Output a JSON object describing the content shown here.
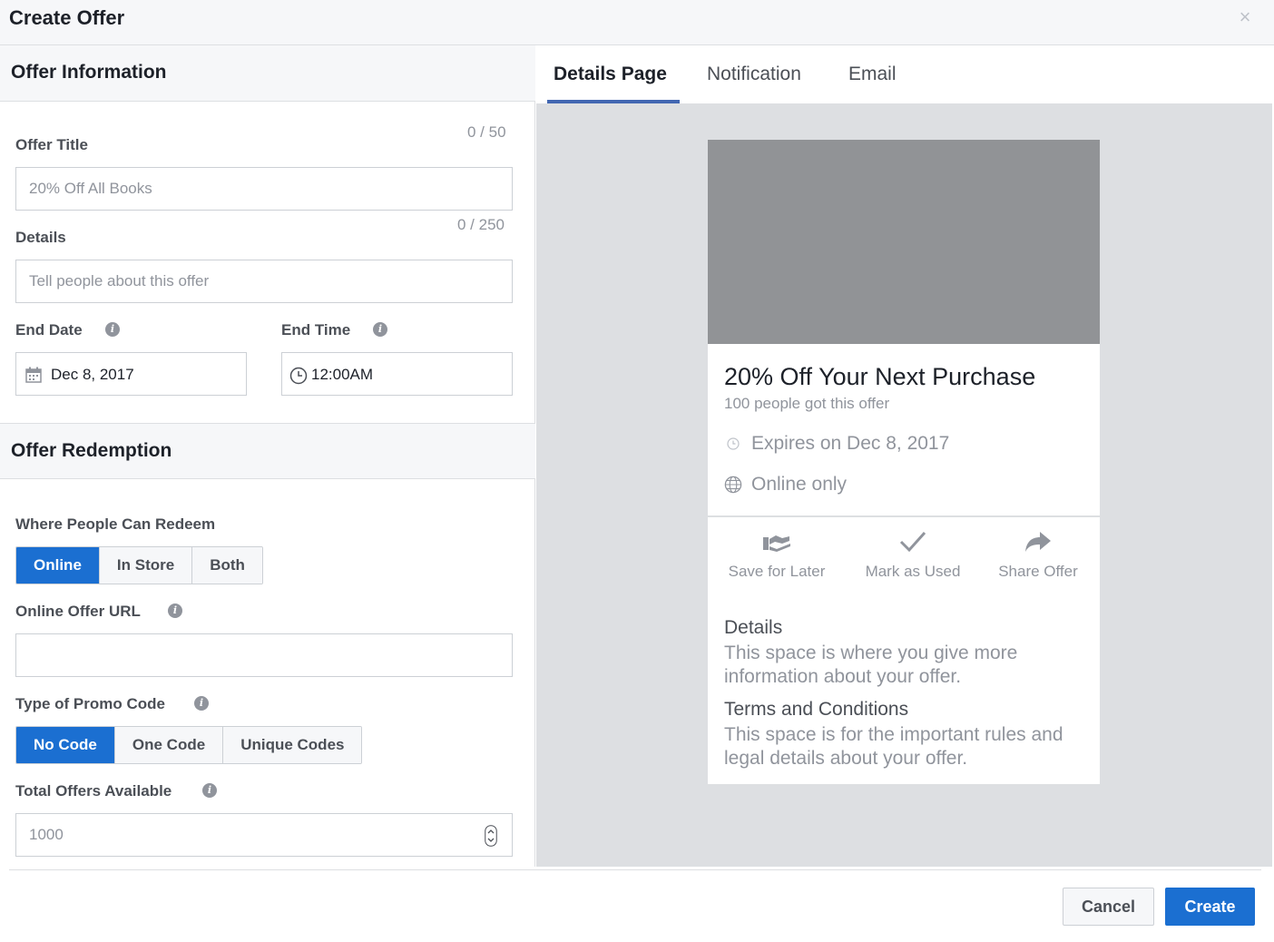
{
  "dialog": {
    "title": "Create Offer",
    "close_label": "×"
  },
  "offer_info": {
    "heading": "Offer Information",
    "title_label": "Offer Title",
    "title_counter": "0 / 50",
    "title_placeholder": "20% Off All Books",
    "details_label": "Details",
    "details_counter": "0 / 250",
    "details_placeholder": "Tell people about this offer",
    "end_date_label": "End Date",
    "end_date_value": "Dec 8, 2017",
    "end_time_label": "End Time",
    "end_time_value": "12:00AM"
  },
  "redemption": {
    "heading": "Offer Redemption",
    "where_label": "Where People Can Redeem",
    "where_options": [
      "Online",
      "In Store",
      "Both"
    ],
    "where_selected": "Online",
    "url_label": "Online Offer URL",
    "url_value": "",
    "promo_label": "Type of Promo Code",
    "promo_options": [
      "No Code",
      "One Code",
      "Unique Codes"
    ],
    "promo_selected": "No Code",
    "total_label": "Total Offers Available",
    "total_placeholder": "1000"
  },
  "preview": {
    "tabs": [
      "Details Page",
      "Notification",
      "Email"
    ],
    "active_tab": "Details Page",
    "headline": "20% Off Your Next Purchase",
    "claimed": "100 people got this offer",
    "expires": "Expires on Dec 8, 2017",
    "channel": "Online only",
    "actions": [
      {
        "label": "Save for Later",
        "icon": "save-icon"
      },
      {
        "label": "Mark as Used",
        "icon": "checkmark-icon"
      },
      {
        "label": "Share Offer",
        "icon": "share-arrow-icon"
      }
    ],
    "details_heading": "Details",
    "details_body": "This space is where you give more information about your offer.",
    "terms_heading": "Terms and Conditions",
    "terms_body": "This space is for the important rules and legal details about your offer."
  },
  "footer": {
    "cancel_label": "Cancel",
    "create_label": "Create"
  },
  "colors": {
    "accent": "#1b6fd1",
    "tab_underline": "#4267b2",
    "preview_bg": "#dddfe2",
    "image_placeholder": "#919396"
  }
}
